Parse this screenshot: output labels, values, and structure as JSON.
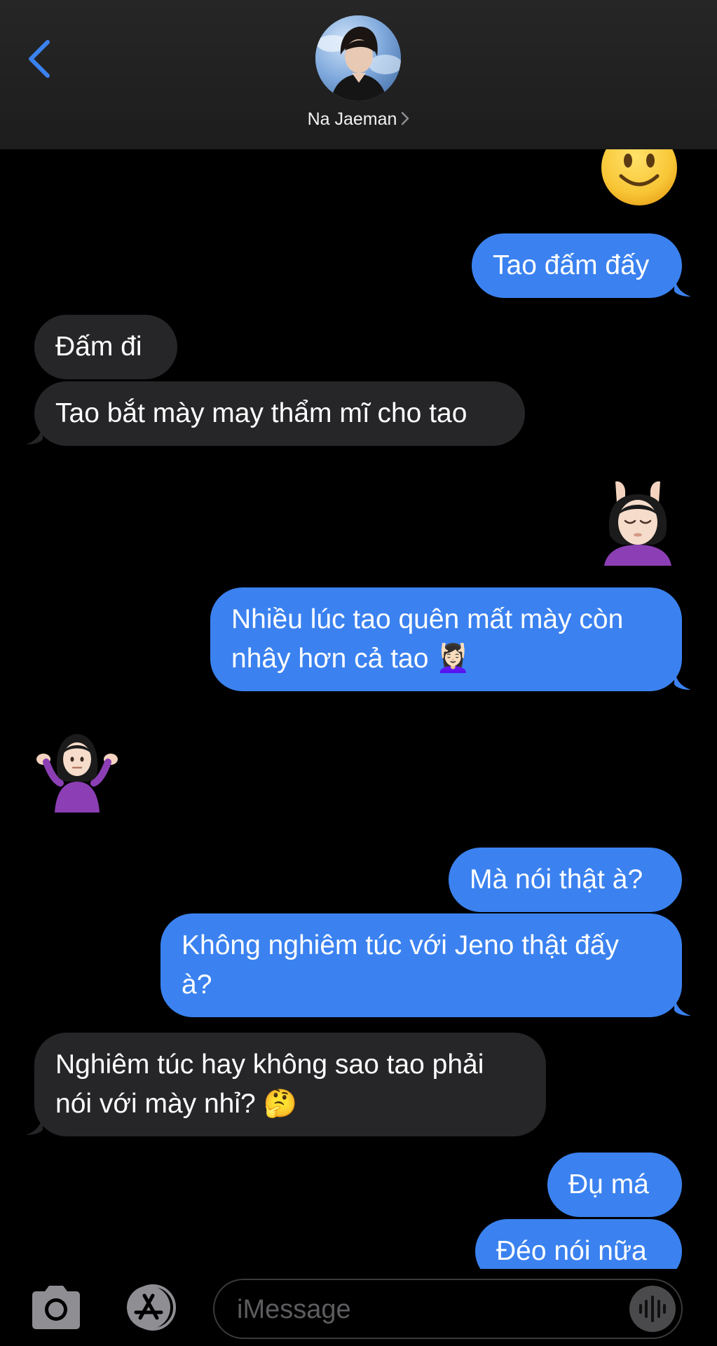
{
  "header": {
    "contact_name": "Na Jaeman",
    "back_icon": "chevron-left-icon",
    "accent": "#3b82f0"
  },
  "messages": [
    {
      "sender": "me",
      "type": "emoji",
      "emoji": "🙂",
      "icon": "slightly-smiling-face-emoji"
    },
    {
      "sender": "me",
      "type": "text",
      "lines": [
        "Tao đấm đấy"
      ]
    },
    {
      "sender": "them",
      "type": "text",
      "lines": [
        "Đấm đi"
      ]
    },
    {
      "sender": "them",
      "type": "text",
      "lines": [
        "Tao bắt mày may thẩm mĩ cho tao"
      ]
    },
    {
      "sender": "me",
      "type": "emoji",
      "emoji": "💆🏻‍♀️",
      "icon": "woman-getting-massage-emoji"
    },
    {
      "sender": "me",
      "type": "text",
      "lines": [
        "Nhiều lúc tao quên mất mày còn",
        "nhây hơn cả tao 💆🏻‍♀️"
      ]
    },
    {
      "sender": "them",
      "type": "emoji",
      "emoji": "🤷🏻‍♀️",
      "icon": "woman-shrugging-emoji"
    },
    {
      "sender": "me",
      "type": "text",
      "lines": [
        "Mà nói thật à?"
      ]
    },
    {
      "sender": "me",
      "type": "text",
      "lines": [
        "Không nghiêm túc với Jeno thật đấy",
        "à?"
      ]
    },
    {
      "sender": "them",
      "type": "text",
      "lines": [
        "Nghiêm túc hay không sao tao phải",
        "nói với mày nhỉ? 🤔"
      ]
    },
    {
      "sender": "me",
      "type": "text",
      "lines": [
        "Đụ má"
      ]
    },
    {
      "sender": "me",
      "type": "text",
      "lines": [
        "Đéo nói nữa"
      ]
    }
  ],
  "input_bar": {
    "placeholder": "iMessage",
    "camera_icon": "camera-icon",
    "apps_icon": "app-store-icon",
    "audio_icon": "audio-waveform-icon"
  },
  "colors": {
    "sent_bubble": "#3b82f0",
    "received_bubble": "#262628",
    "background": "#000000"
  }
}
